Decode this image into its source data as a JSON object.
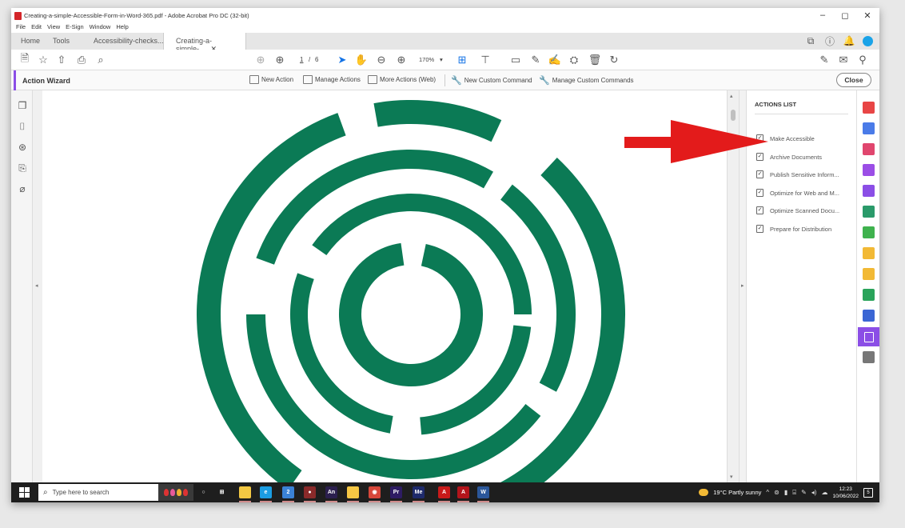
{
  "window": {
    "title": "Creating-a-simple-Accessible-Form-in-Word-365.pdf - Adobe Acrobat Pro DC (32-bit)",
    "controls": {
      "minimize": "–",
      "restore": "◻",
      "close": "✕"
    }
  },
  "menu": [
    "File",
    "Edit",
    "View",
    "E-Sign",
    "Window",
    "Help"
  ],
  "tabs": [
    {
      "label": "Home"
    },
    {
      "label": "Tools"
    },
    {
      "label": "Accessibility-checks..."
    },
    {
      "label": "Creating-a-simple-...",
      "active": true,
      "close": "✕"
    }
  ],
  "toolbar": {
    "current_page": "1",
    "page_separator": "/",
    "total_pages": "6",
    "zoom": "170%",
    "zoom_caret": "▾"
  },
  "action_wizard": {
    "label": "Action Wizard",
    "buttons": {
      "new_action": "New Action",
      "manage_actions": "Manage Actions",
      "more_actions": "More Actions (Web)",
      "new_custom_command": "New Custom Command",
      "manage_custom_commands": "Manage Custom Commands"
    },
    "close_label": "Close"
  },
  "actions_list": {
    "title": "ACTIONS LIST",
    "items": [
      "Make Accessible",
      "Archive Documents",
      "Publish Sensitive Inform...",
      "Optimize for Web and M...",
      "Optimize Scanned Docu...",
      "Prepare for Distribution"
    ]
  },
  "taskbar": {
    "search_placeholder": "Type here to search",
    "apps": [
      {
        "name": "cortana",
        "label": "○",
        "color": "#1e1e1e"
      },
      {
        "name": "task-view",
        "label": "⊞",
        "color": "#1e1e1e"
      },
      {
        "name": "file-explorer",
        "label": "",
        "color": "#f3c843"
      },
      {
        "name": "edge",
        "label": "e",
        "color": "#1b9de2"
      },
      {
        "name": "mail",
        "label": "2",
        "color": "#3b82d6"
      },
      {
        "name": "davinci",
        "label": "●",
        "color": "#8a2a2a"
      },
      {
        "name": "animate",
        "label": "An",
        "color": "#2b1f4e"
      },
      {
        "name": "sticky-notes",
        "label": "",
        "color": "#f6c744"
      },
      {
        "name": "chrome",
        "label": "◉",
        "color": "#d7473a"
      },
      {
        "name": "premiere",
        "label": "Pr",
        "color": "#2e1c63"
      },
      {
        "name": "media-encoder",
        "label": "Me",
        "color": "#1e2a6b"
      },
      {
        "name": "acrobat-reader",
        "label": "A",
        "color": "#c91a1a"
      },
      {
        "name": "acrobat-pro",
        "label": "A",
        "color": "#b3141b"
      },
      {
        "name": "word",
        "label": "W",
        "color": "#2b579a"
      }
    ],
    "weather": "19°C  Partly sunny",
    "time": "12:23",
    "date": "10/06/2022",
    "notifications": "5"
  },
  "colors": {
    "logo_green": "#0b7a55",
    "accent_purple": "#8b4ee6",
    "arrow_red": "#e31b1b",
    "acrobat_blue": "#1473e6"
  }
}
